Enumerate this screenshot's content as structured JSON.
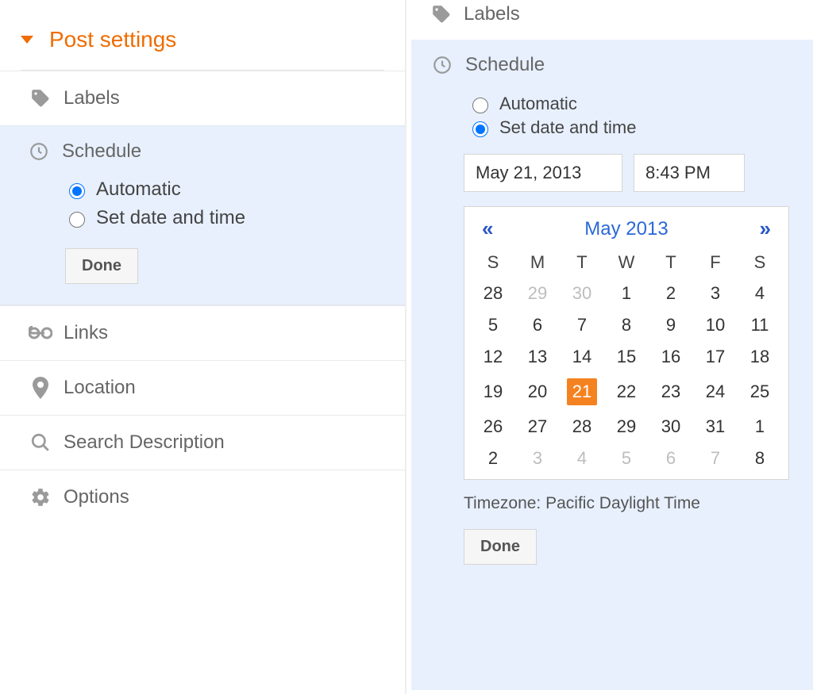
{
  "left": {
    "header": "Post settings",
    "items": {
      "labels": "Labels",
      "links": "Links",
      "location": "Location",
      "search": "Search Description",
      "options": "Options"
    },
    "schedule": {
      "title": "Schedule",
      "opt_auto": "Automatic",
      "opt_set": "Set date and time",
      "done": "Done"
    }
  },
  "right": {
    "labels": "Labels",
    "schedule": {
      "title": "Schedule",
      "opt_auto": "Automatic",
      "opt_set": "Set date and time",
      "date_value": "May 21, 2013",
      "time_value": "8:43 PM",
      "cal_title": "May 2013",
      "dow": [
        "S",
        "M",
        "T",
        "W",
        "T",
        "F",
        "S"
      ],
      "weeks": [
        [
          {
            "n": "28",
            "o": false
          },
          {
            "n": "29",
            "o": true
          },
          {
            "n": "30",
            "o": true
          },
          {
            "n": "1",
            "o": false
          },
          {
            "n": "2",
            "o": false
          },
          {
            "n": "3",
            "o": false
          },
          {
            "n": "4",
            "o": false
          }
        ],
        [
          {
            "n": "5",
            "o": false
          },
          {
            "n": "6",
            "o": false
          },
          {
            "n": "7",
            "o": false
          },
          {
            "n": "8",
            "o": false
          },
          {
            "n": "9",
            "o": false
          },
          {
            "n": "10",
            "o": false
          },
          {
            "n": "11",
            "o": false
          }
        ],
        [
          {
            "n": "12",
            "o": false
          },
          {
            "n": "13",
            "o": false
          },
          {
            "n": "14",
            "o": false
          },
          {
            "n": "15",
            "o": false
          },
          {
            "n": "16",
            "o": false
          },
          {
            "n": "17",
            "o": false
          },
          {
            "n": "18",
            "o": false
          }
        ],
        [
          {
            "n": "19",
            "o": false
          },
          {
            "n": "20",
            "o": false
          },
          {
            "n": "21",
            "o": false,
            "sel": true
          },
          {
            "n": "22",
            "o": false
          },
          {
            "n": "23",
            "o": false
          },
          {
            "n": "24",
            "o": false
          },
          {
            "n": "25",
            "o": false
          }
        ],
        [
          {
            "n": "26",
            "o": false
          },
          {
            "n": "27",
            "o": false
          },
          {
            "n": "28",
            "o": false
          },
          {
            "n": "29",
            "o": false
          },
          {
            "n": "30",
            "o": false
          },
          {
            "n": "31",
            "o": false
          },
          {
            "n": "1",
            "o": false
          }
        ],
        [
          {
            "n": "2",
            "o": false
          },
          {
            "n": "3",
            "o": true
          },
          {
            "n": "4",
            "o": true
          },
          {
            "n": "5",
            "o": true
          },
          {
            "n": "6",
            "o": true
          },
          {
            "n": "7",
            "o": true
          },
          {
            "n": "8",
            "o": false
          }
        ]
      ],
      "tz": "Timezone: Pacific Daylight Time",
      "done": "Done"
    }
  }
}
